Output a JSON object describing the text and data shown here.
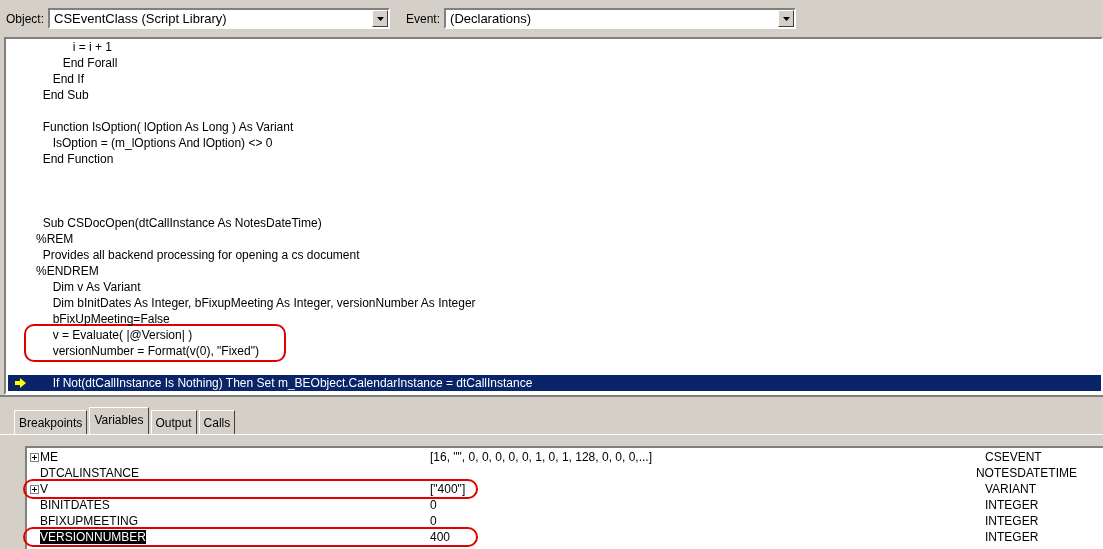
{
  "toolbar": {
    "object": {
      "label": "Object:",
      "value": "CSEventClass (Script Library)"
    },
    "event": {
      "label": "Event:",
      "value": "(Declarations)"
    }
  },
  "code": [
    {
      "kind": "line",
      "text": "           i = i + 1"
    },
    {
      "kind": "line",
      "text": "        End Forall"
    },
    {
      "kind": "line",
      "text": "     End If"
    },
    {
      "kind": "line",
      "text": "  End Sub"
    },
    {
      "kind": "blank"
    },
    {
      "kind": "line",
      "text": "  Function IsOption( lOption As Long ) As Variant"
    },
    {
      "kind": "line",
      "text": "     IsOption = (m_lOptions And lOption) <> 0"
    },
    {
      "kind": "line",
      "text": "  End Function"
    },
    {
      "kind": "blank"
    },
    {
      "kind": "blank"
    },
    {
      "kind": "blank"
    },
    {
      "kind": "line",
      "text": "  Sub CSDocOpen(dtCallInstance As NotesDateTime)"
    },
    {
      "kind": "line",
      "text": "%REM"
    },
    {
      "kind": "line",
      "text": "  Provides all backend processing for opening a cs document"
    },
    {
      "kind": "line",
      "text": "%ENDREM"
    },
    {
      "kind": "line",
      "text": "     Dim v As Variant"
    },
    {
      "kind": "line",
      "text": "     Dim bInitDates As Integer, bFixupMeeting As Integer, versionNumber As Integer"
    },
    {
      "kind": "line",
      "text": "     bFixUpMeeting=False"
    },
    {
      "kind": "circled",
      "lines": [
        "     v = Evaluate( |@Version| )",
        "     versionNumber = Format(v(0), \"Fixed\")"
      ]
    },
    {
      "kind": "blank"
    },
    {
      "kind": "current",
      "text": "     If Not(dtCallInstance Is Nothing) Then Set m_BEObject.CalendarInstance = dtCallInstance"
    }
  ],
  "tabs": [
    {
      "label": "Breakpoints",
      "selected": false
    },
    {
      "label": "Variables",
      "selected": true
    },
    {
      "label": "Output",
      "selected": false
    },
    {
      "label": "Calls",
      "selected": false
    }
  ],
  "variables": [
    {
      "name": "ME",
      "value": "[16, \"\", 0, 0, 0, 0, 0, 1, 0, 1, 128, 0, 0, 0,...]",
      "type": "CSEVENT",
      "expandable": true,
      "selected": false,
      "circled": false
    },
    {
      "name": "DTCALINSTANCE",
      "type": "NOTESDATETIME",
      "expandable": false,
      "selected": false,
      "circled": false
    },
    {
      "name": "V",
      "value": "[\"400\"]",
      "type": "VARIANT",
      "expandable": true,
      "selected": false,
      "circled": true
    },
    {
      "name": "BINITDATES",
      "value": "0",
      "type": "INTEGER",
      "expandable": false,
      "selected": false,
      "circled": false
    },
    {
      "name": "BFIXUPMEETING",
      "value": "0",
      "type": "INTEGER",
      "expandable": false,
      "selected": false,
      "circled": false
    },
    {
      "name": "VERSIONNUMBER",
      "value": "400",
      "type": "INTEGER",
      "expandable": false,
      "selected": true,
      "circled": true
    }
  ]
}
